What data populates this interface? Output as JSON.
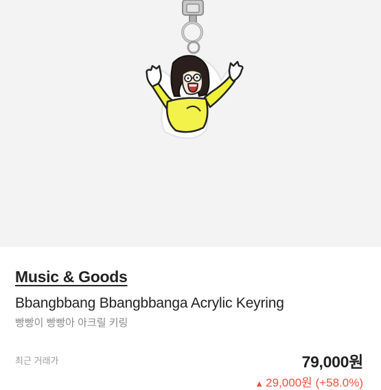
{
  "product": {
    "image_icon": "keyring-illustration",
    "brand": "Music & Goods",
    "name_en": "Bbangbbang Bbangbbanga Acrylic Keyring",
    "name_ko": "빵빵이 빵빵아 아크릴 키링"
  },
  "trade": {
    "recent_label": "최근 거래가",
    "price": "79,000원",
    "change_arrow": "▲",
    "change_amount": "29,000원",
    "change_percent": "(+58.0%)"
  },
  "colors": {
    "background": "#f3f3f3",
    "price_up": "#ef4f3e",
    "shirt": "#f2f24a"
  }
}
